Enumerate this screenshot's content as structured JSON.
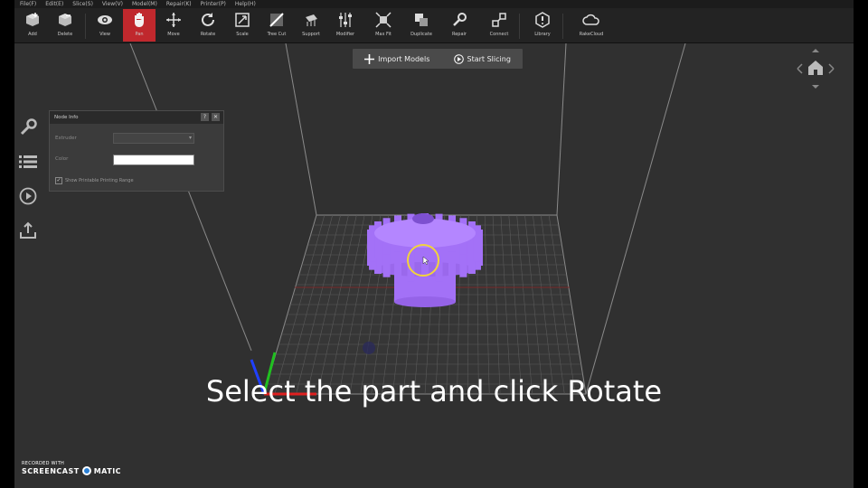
{
  "menu": [
    "File(F)",
    "Edit(E)",
    "Slice(S)",
    "View(V)",
    "Model(M)",
    "Repair(K)",
    "Printer(P)",
    "Help(H)"
  ],
  "toolbar": {
    "add": "Add",
    "delete": "Delete",
    "view": "View",
    "pan": "Pan",
    "move": "Move",
    "rotate": "Rotate",
    "scale": "Scale",
    "tree_cut": "Tree Cut",
    "support": "Support",
    "modifier": "Modifier",
    "max_fit": "Max Fit",
    "duplicate": "Duplicate",
    "repair": "Repair",
    "connect": "Connect",
    "library": "Library",
    "rakecloud": "RakeCloud"
  },
  "actions": {
    "import_models": "Import Models",
    "start_slicing": "Start Slicing"
  },
  "node_info": {
    "title": "Node Info",
    "help": "?",
    "close": "✕",
    "extruder_label": "Extruder",
    "color_label": "Color",
    "checkbox_label": "Show Printable Printing Range",
    "checked": true,
    "color": "#ffffff"
  },
  "caption": "Select the part and click Rotate",
  "watermark": {
    "line1": "RECORDED WITH",
    "brand_left": "SCREENCAST",
    "brand_right": "MATIC"
  },
  "colors": {
    "active_tool": "#c0282d",
    "model": "#a371f7",
    "axis_x": "#e02020",
    "axis_y": "#20c020",
    "axis_z": "#2040ff",
    "cursor_ring": "#f2d43a"
  }
}
